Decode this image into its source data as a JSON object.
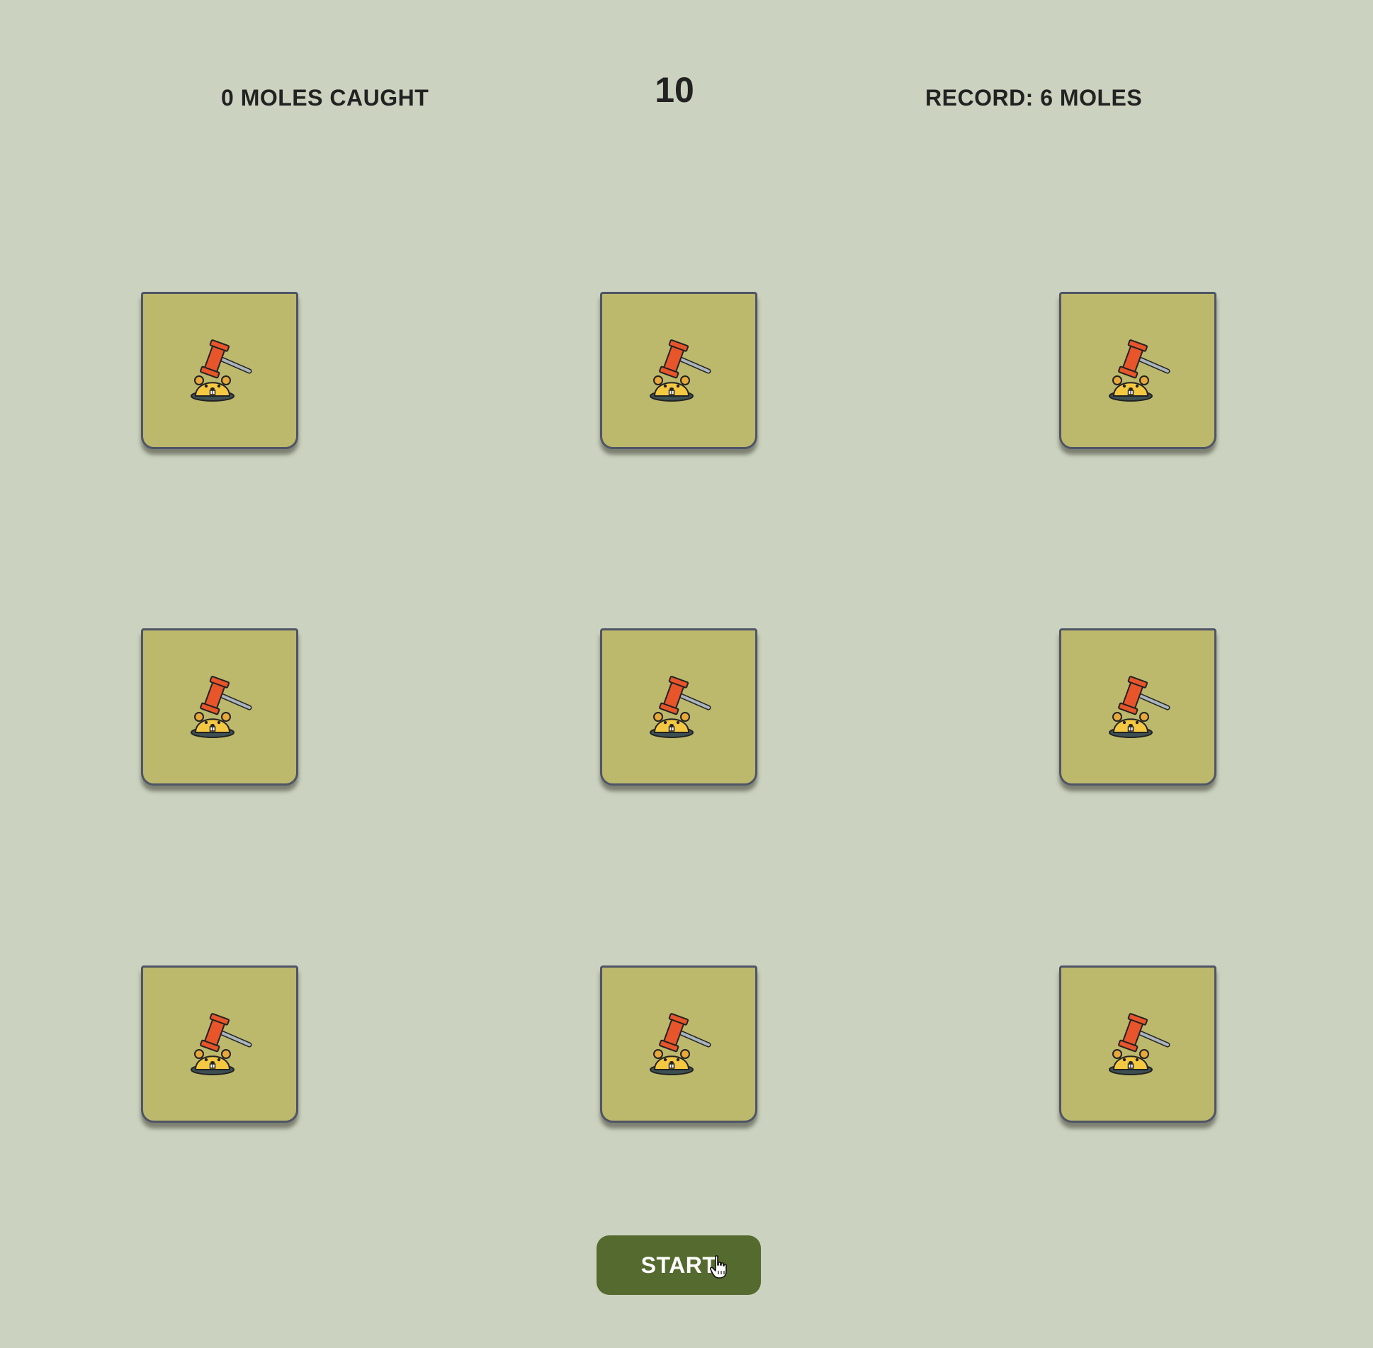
{
  "header": {
    "score_text": "0 MOLES CAUGHT",
    "timer": "10",
    "record_text": "RECORD: 6 MOLES"
  },
  "board": {
    "rows": 3,
    "cols": 3,
    "hole_icon": "mole-hammer-icon",
    "hole_color": "#bcb86c"
  },
  "controls": {
    "start_label": "START",
    "start_color": "#556a2e"
  },
  "cursor_icon": "hand-pointer-icon"
}
